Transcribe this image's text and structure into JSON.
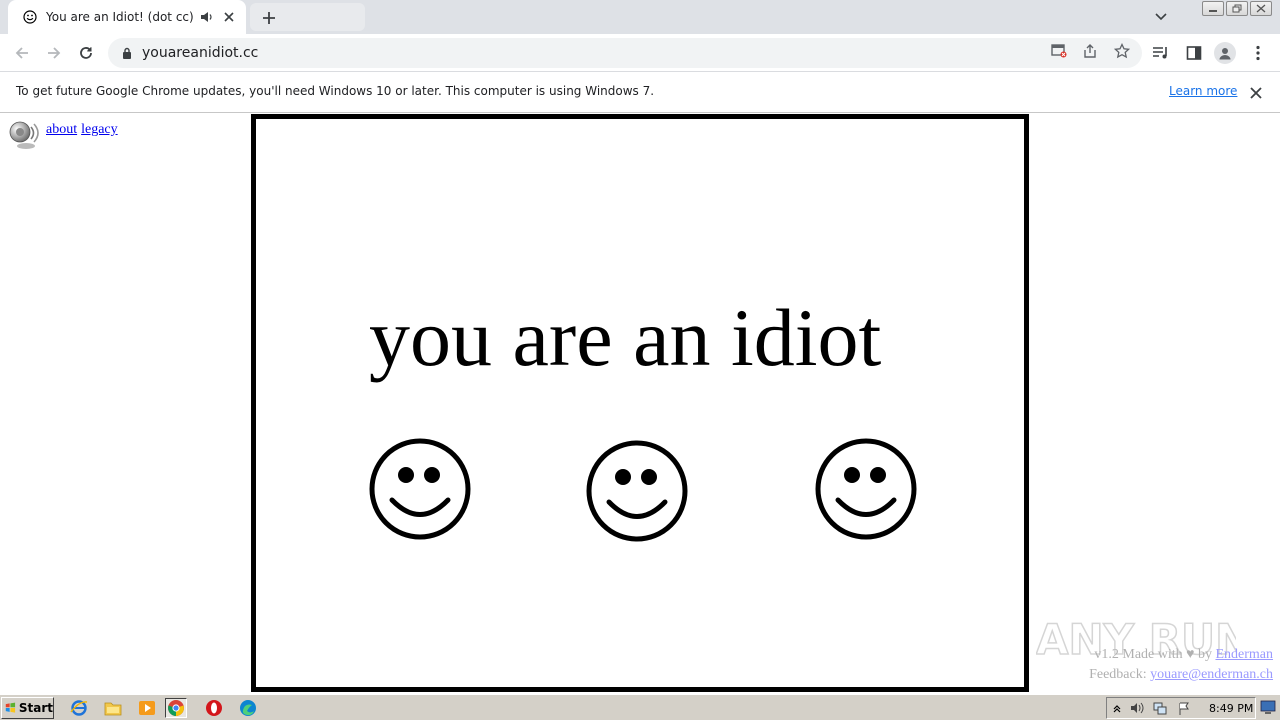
{
  "browser": {
    "tab_title": "You are an Idiot! (dot cc)",
    "url": "youareanidiot.cc"
  },
  "infobar": {
    "message": "To get future Google Chrome updates, you'll need Windows 10 or later. This computer is using Windows 7.",
    "learn_more": "Learn more"
  },
  "page": {
    "links": [
      "about",
      "legacy"
    ],
    "headline": "you are an idiot",
    "footer_line1_prefix": "v1.2 Made with",
    "footer_line1_mid": "by",
    "footer_author": "Enderman",
    "footer_line2_prefix": "Feedback:",
    "footer_email": "youare@enderman.ch"
  },
  "watermark": {
    "text": "ANY RUN"
  },
  "taskbar": {
    "start_label": "Start",
    "clock": "8:49 PM",
    "icons": [
      "ie-icon",
      "explorer-icon",
      "media-player-icon",
      "chrome-icon",
      "opera-icon",
      "edge-icon"
    ]
  },
  "colors": {
    "link": "#0000ee",
    "chrome_blue": "#1a73e8",
    "taskbar": "#d4d0c8"
  }
}
